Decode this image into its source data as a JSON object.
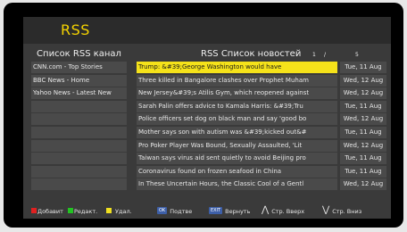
{
  "app": {
    "title": "RSS"
  },
  "channels": {
    "header": "Список RSS канал",
    "items": [
      "CNN.com - Top Stories",
      "BBC News - Home",
      "Yahoo News - Latest New",
      "",
      "",
      "",
      "",
      "",
      "",
      ""
    ]
  },
  "news": {
    "header": "RSS Список новостей",
    "page_current": "1",
    "page_sep": "/",
    "page_total": "5",
    "selected_index": 0,
    "items": [
      {
        "title": "Trump: &#39;George Washington would have",
        "date": "Tue, 11 Aug"
      },
      {
        "title": "Three killed in Bangalore clashes over Prophet Muham",
        "date": "Wed, 12 Aug"
      },
      {
        "title": "New Jersey&#39;s Atilis Gym, which reopened against",
        "date": "Wed, 12 Aug"
      },
      {
        "title": "Sarah Palin offers advice to Kamala Harris: &#39;Tru",
        "date": "Tue, 11 Aug"
      },
      {
        "title": "Police officers set dog on black man and say 'good bo",
        "date": "Wed, 12 Aug"
      },
      {
        "title": "Mother says son with autism was &#39;kicked out&#",
        "date": "Tue, 11 Aug"
      },
      {
        "title": "Pro Poker Player Was Bound, Sexually Assaulted, 'Lit",
        "date": "Wed, 12 Aug"
      },
      {
        "title": "Taiwan says virus aid sent quietly to avoid Beijing pro",
        "date": "Tue, 11 Aug"
      },
      {
        "title": "Coronavirus found on frozen seafood in China",
        "date": "Tue, 11 Aug"
      },
      {
        "title": "In These Uncertain Hours, the Classic Cool of a Gentl",
        "date": "Wed, 12 Aug"
      }
    ]
  },
  "footer": {
    "add": {
      "label": "Добавит",
      "color": "#e02020"
    },
    "edit": {
      "label": "Редакт.",
      "color": "#22c322"
    },
    "delete": {
      "label": "Удал.",
      "color": "#f0e020"
    },
    "ok": {
      "key": "OK",
      "label": "Подтве"
    },
    "exit": {
      "key": "EXIT",
      "label": "Вернуть"
    },
    "page_up": {
      "icon": "chevron-up-icon",
      "label": "Стр. Вверх"
    },
    "page_down": {
      "icon": "chevron-down-icon",
      "label": "Стр. Вниз"
    }
  }
}
